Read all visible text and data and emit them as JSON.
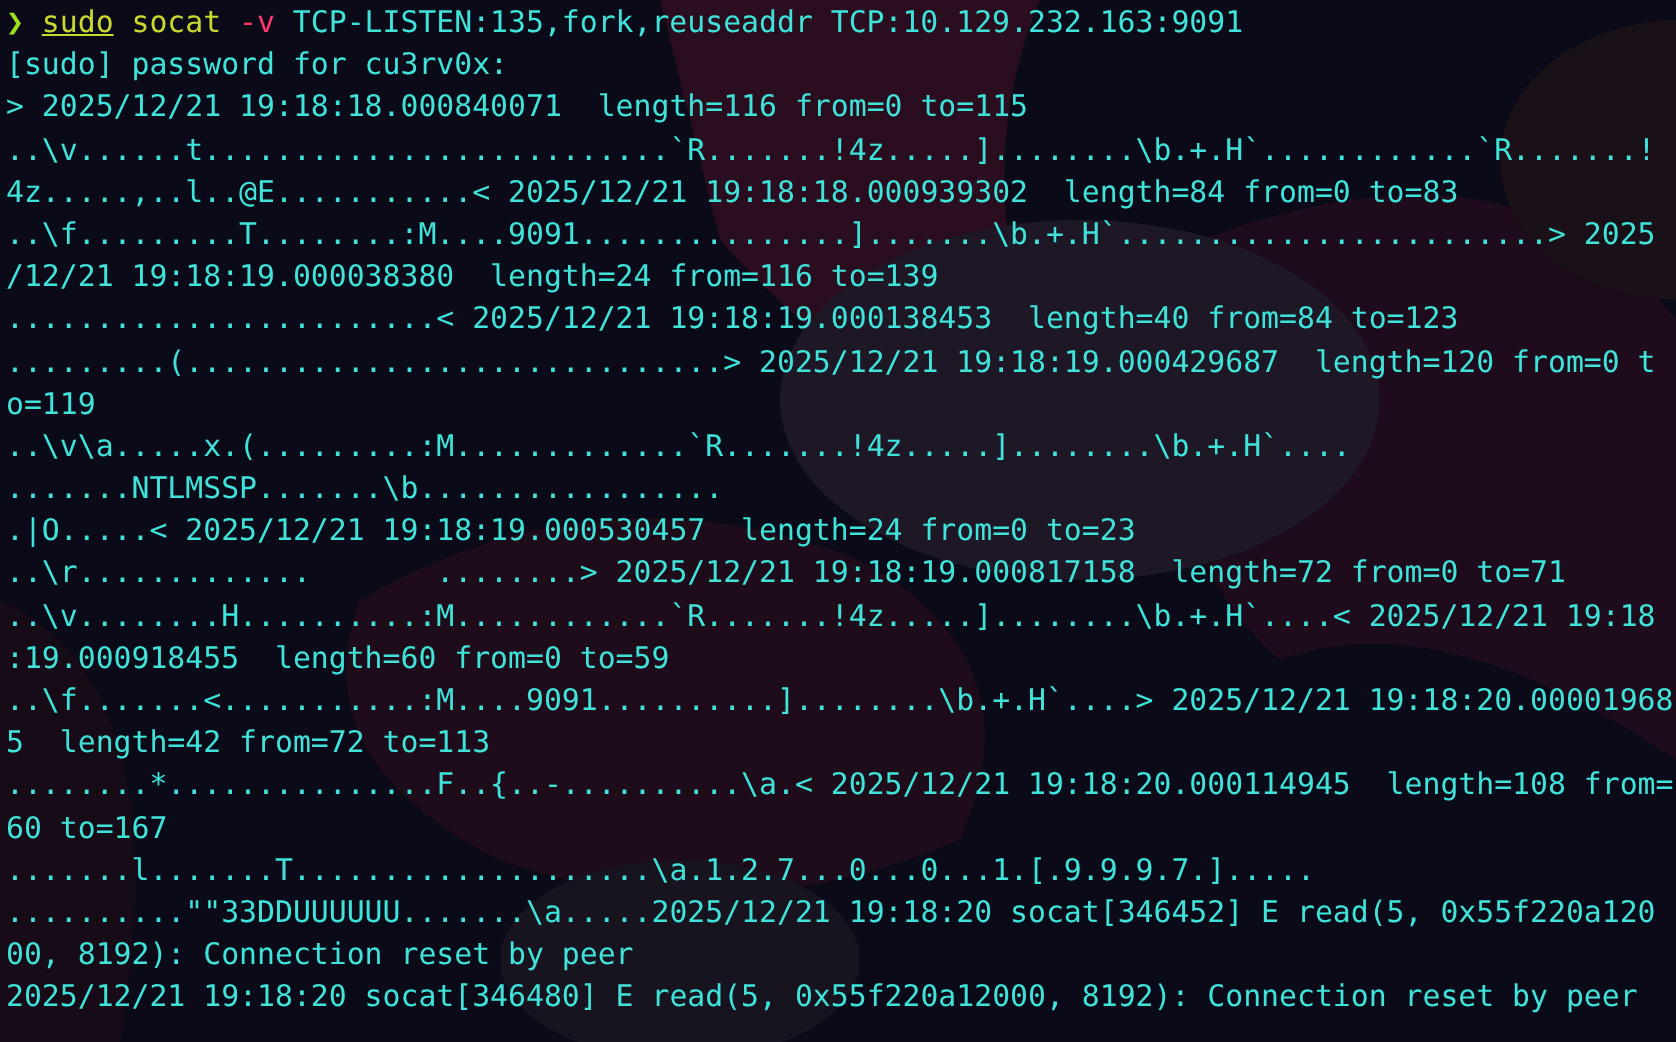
{
  "prompt": {
    "symbol": "❯",
    "tokens": [
      {
        "text": "sudo",
        "kind": "builtin"
      },
      {
        "text": "socat",
        "kind": "command"
      },
      {
        "text": "-v",
        "kind": "option"
      },
      {
        "text": "TCP-LISTEN:135,fork,reuseaddr",
        "kind": "argument"
      },
      {
        "text": "TCP:10.129.232.163:9091",
        "kind": "argument"
      }
    ]
  },
  "lines": [
    "[sudo] password for cu3rv0x:",
    "> 2025/12/21 19:18:18.000840071  length=116 from=0 to=115",
    "..\\v......t..........................`R.......!4z.....]........\\b.+.H`............`R.......!",
    "4z.....,..l..@E...........< 2025/12/21 19:18:18.000939302  length=84 from=0 to=83",
    "..\\f.........T........:M....9091...............].......\\b.+.H`........................> 2025",
    "/12/21 19:18:19.000038380  length=24 from=116 to=139",
    "........................< 2025/12/21 19:18:19.000138453  length=40 from=84 to=123",
    ".........(..............................> 2025/12/21 19:18:19.000429687  length=120 from=0 t",
    "o=119",
    "..\\v\\a.....x.(.........:M.............`R.......!4z.....]........\\b.+.H`....",
    ".......NTLMSSP.......\\b.................",
    ".|O.....< 2025/12/21 19:18:19.000530457  length=24 from=0 to=23",
    "..\\r.............       ........> 2025/12/21 19:18:19.000817158  length=72 from=0 to=71",
    "..\\v........H..........:M............`R.......!4z.....]........\\b.+.H`....< 2025/12/21 19:18",
    ":19.000918455  length=60 from=0 to=59",
    "..\\f.......<...........:M....9091..........]........\\b.+.H`....> 2025/12/21 19:18:20.00001968",
    "5  length=42 from=72 to=113",
    "........*...............F..{..-..........\\a.< 2025/12/21 19:18:20.000114945  length=108 from=",
    "60 to=167",
    ".......l.......T....................\\a.1.2.7...0...0...1.[.9.9.9.7.].....",
    "..........\"\"33DDUUUUUU.......\\a.....2025/12/21 19:18:20 socat[346452] E read(5, 0x55f220a120",
    "00, 8192): Connection reset by peer",
    "2025/12/21 19:18:20 socat[346480] E read(5, 0x55f220a12000, 8192): Connection reset by peer"
  ]
}
